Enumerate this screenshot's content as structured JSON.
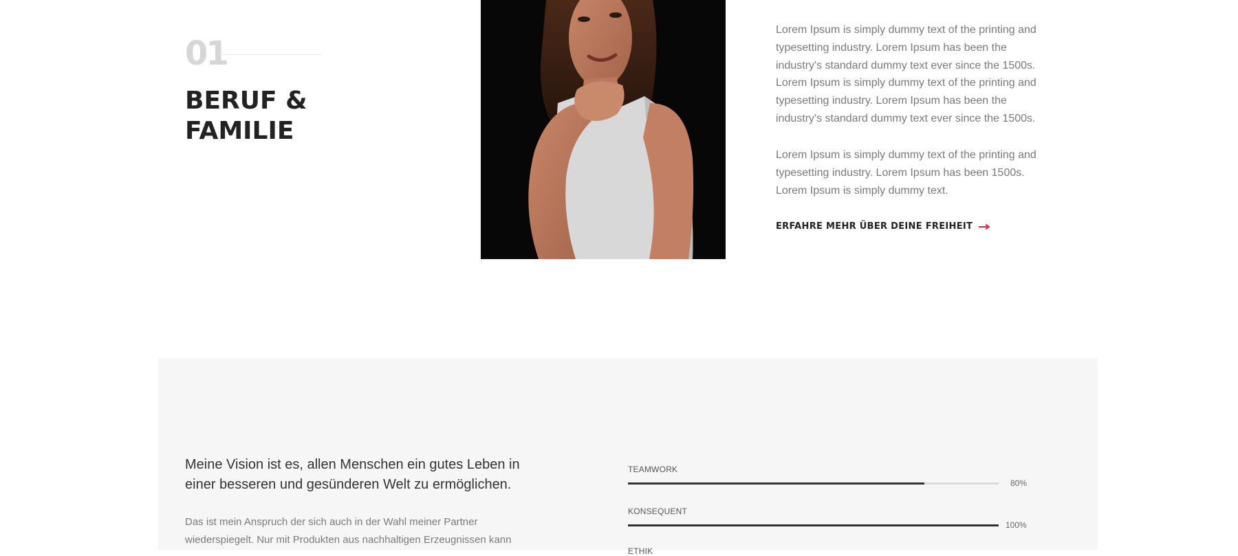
{
  "section": {
    "number": "01",
    "title_line1": "BERUF &",
    "title_line2": "FAMILIE"
  },
  "portrait": {
    "alt": "Portrait einer Frau mit dunklen, schulterlangen Haaren, in weißem Top vor schwarzem Hintergrund"
  },
  "intro": {
    "paragraph1": "Lorem Ipsum is simply dummy text of the printing and typesetting industry. Lorem Ipsum has been the industry's standard dummy text ever since the 1500s. Lorem Ipsum is simply dummy text of the printing and typesetting industry. Lorem Ipsum has been the industry's standard dummy text ever since the 1500s.",
    "paragraph2": "Lorem Ipsum is simply dummy text of the printing and typesetting industry. Lorem Ipsum has been 1500s. Lorem Ipsum is simply dummy text.",
    "link_label": "ERFAHRE MEHR ÜBER DEINE FREIHEIT"
  },
  "vision": {
    "headline": "Meine Vision ist es, allen Menschen ein gutes Leben in einer besseren und gesünderen Welt zu ermöglichen.",
    "body": "Das ist mein Anspruch der sich auch in der Wahl meiner Partner wiederspiegelt. Nur mit Produkten aus nachhaltigen Erzeugnissen kann"
  },
  "skills": [
    {
      "name": "TEAMWORK",
      "percent": 80,
      "label": "80%"
    },
    {
      "name": "KONSEQUENT",
      "percent": 100,
      "label": "100%"
    },
    {
      "name": "ETHIK"
    }
  ],
  "colors": {
    "accent": "#e8264a",
    "heading": "#222222",
    "body_text": "#7a7a7a",
    "band_bg": "#f6f6f6",
    "bar_fill": "#333333",
    "bar_track": "#d9d9d9"
  },
  "icons": {
    "link_arrow": "arrow-right-icon"
  }
}
